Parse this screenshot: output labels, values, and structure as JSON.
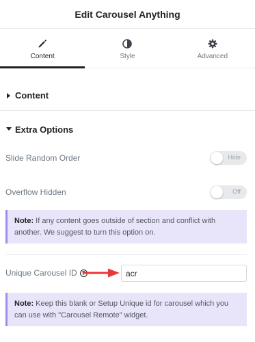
{
  "header": {
    "title": "Edit Carousel Anything"
  },
  "tabs": [
    {
      "label": "Content",
      "icon": "pencil-icon",
      "active": true
    },
    {
      "label": "Style",
      "icon": "contrast-icon",
      "active": false
    },
    {
      "label": "Advanced",
      "icon": "gear-icon",
      "active": false
    }
  ],
  "sections": {
    "content": {
      "title": "Content",
      "expanded": false
    },
    "extra": {
      "title": "Extra Options",
      "expanded": true
    }
  },
  "controls": {
    "random_order": {
      "label": "Slide Random Order",
      "state_text": "Hide"
    },
    "overflow_hidden": {
      "label": "Overflow Hidden",
      "state_text": "Off"
    },
    "unique_id": {
      "label": "Unique Carousel ID",
      "value": "acr"
    }
  },
  "notices": {
    "overflow": {
      "strong": "Note:",
      "text": " If any content goes outside of section and conflict with another. We suggest to turn this option on."
    },
    "unique_id": {
      "strong": "Note:",
      "text": " Keep this blank or Setup Unique id for carousel which you can use with \"Carousel Remote\" widget."
    }
  },
  "colors": {
    "accent": "#1f2124",
    "notice_bg": "#e8e5fb",
    "notice_border": "#9b8ef0",
    "arrow": "#e8393a"
  }
}
